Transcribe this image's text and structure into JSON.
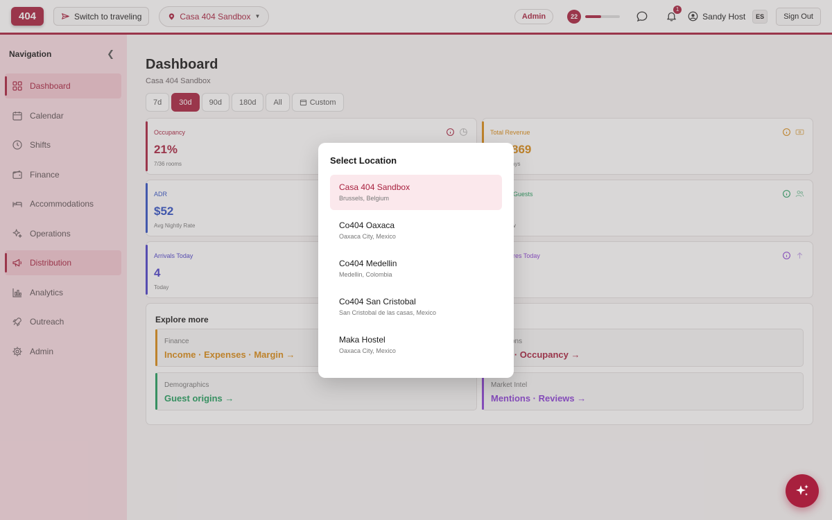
{
  "topbar": {
    "logo": "404",
    "switch_label": "Switch to traveling",
    "location_label": "Casa 404 Sandbox",
    "admin_label": "Admin",
    "level": "22",
    "level_progress": 0.45,
    "notif_count": "1",
    "user_name": "Sandy Host",
    "lang": "ES",
    "signout_label": "Sign Out"
  },
  "sidebar": {
    "title": "Navigation",
    "items": [
      {
        "label": "Dashboard",
        "icon": "grid-icon"
      },
      {
        "label": "Calendar",
        "icon": "calendar-icon"
      },
      {
        "label": "Shifts",
        "icon": "clock-icon"
      },
      {
        "label": "Finance",
        "icon": "wallet-icon"
      },
      {
        "label": "Accommodations",
        "icon": "bed-icon"
      },
      {
        "label": "Operations",
        "icon": "sparkle-icon"
      },
      {
        "label": "Distribution",
        "icon": "megaphone-icon"
      },
      {
        "label": "Analytics",
        "icon": "bar-chart-icon"
      },
      {
        "label": "Outreach",
        "icon": "rocket-icon"
      },
      {
        "label": "Admin",
        "icon": "gear-icon"
      }
    ]
  },
  "main": {
    "title": "Dashboard",
    "subtitle": "Casa 404 Sandbox",
    "ranges": [
      "7d",
      "30d",
      "90d",
      "180d",
      "All",
      "Custom"
    ],
    "cards": {
      "occupancy": {
        "label": "Occupancy",
        "value": "21%",
        "sub": "7/36 rooms"
      },
      "revenue": {
        "label": "Total Revenue",
        "value": "869",
        "sub": "ays"
      },
      "adr": {
        "label": "ADR",
        "value": "$52",
        "sub": "Avg Nightly Rate"
      },
      "guests": {
        "label": "Guests",
        "sub": "v"
      },
      "arrivals": {
        "label": "Arrivals Today",
        "value": "4",
        "sub": "Today"
      },
      "departures": {
        "label": "res Today"
      }
    },
    "explore": {
      "title": "Explore more",
      "finance": {
        "label": "Finance",
        "links": "Income · Expenses · Margin →"
      },
      "ops": {
        "label": "ons",
        "links": "y · Occupancy →"
      },
      "demo": {
        "label": "Demographics",
        "links": "Guest origins →"
      },
      "market": {
        "label": "Market Intel",
        "links": "Mentions · Reviews →"
      }
    }
  },
  "modal": {
    "title": "Select Location",
    "locations": [
      {
        "name": "Casa 404 Sandbox",
        "city": "Brussels, Belgium"
      },
      {
        "name": "Co404 Oaxaca",
        "city": "Oaxaca City, Mexico"
      },
      {
        "name": "Co404 Medellin",
        "city": "Medellin, Colombia"
      },
      {
        "name": "Co404 San Cristobal",
        "city": "San Cristobal de las casas, Mexico"
      },
      {
        "name": "Maka Hostel",
        "city": "Oaxaca City, Mexico"
      }
    ]
  },
  "colors": {
    "brand": "#a8203e",
    "occupancy": "#a8203e",
    "revenue": "#d98a12",
    "adr": "#2f4fc4",
    "guests": "#1f9d5c",
    "arrivals": "#4a3fc9",
    "market": "#8a3fd6"
  }
}
